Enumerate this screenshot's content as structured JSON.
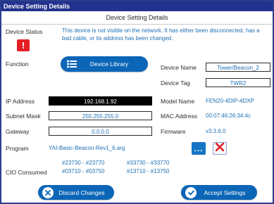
{
  "window": {
    "title": "Device Setting Details",
    "header": "Device Setting Details"
  },
  "status": {
    "label": "Device Status",
    "icon": "alert-icon",
    "icon_glyph": "!",
    "message": "This device is not visible on the network.  It has either been disconnected, has a bad cable, or its address has been changed."
  },
  "function": {
    "label": "Function",
    "button_label": "Device Library",
    "button_icon": "list-icon"
  },
  "device": {
    "name_label": "Device Name",
    "name_value": "Tower/Beacon_2",
    "tag_label": "Device Tag",
    "tag_value": "TWR2",
    "model_label": "Model Name",
    "model_value": "FEN20-4DIP-4DXP",
    "mac_label": "MAC Address",
    "mac_value": "00:07:46:26:34:4c",
    "firmware_label": "Firmware",
    "firmware_value": "v3.3.6.0"
  },
  "network": {
    "ip_label": "IP Address",
    "ip_value": "192.168.1.92",
    "subnet_label": "Subnet Mask",
    "subnet_value": "255.255.255.0",
    "gateway_label": "Gateway",
    "gateway_value": "0.0.0.0"
  },
  "program": {
    "label": "Program",
    "value": "YAI-Basic-Beacon-Rev1_6.arg",
    "browse_label": "...",
    "clear_icon": "red-x-icon"
  },
  "cio": {
    "label": "CIO Consumed",
    "ranges": [
      "#23730 - #23770",
      "#33730 - #33770",
      "#03710 - #03750",
      "#13710 - #13750"
    ]
  },
  "actions": {
    "discard_label": "Discard Changes",
    "discard_icon": "close-circle-icon",
    "accept_label": "Accept Settings",
    "accept_icon": "check-circle-icon"
  },
  "colors": {
    "titlebar": "#23328e",
    "accent": "#0b66b7",
    "value_text": "#1e6fb3",
    "alert": "#e31e25"
  }
}
